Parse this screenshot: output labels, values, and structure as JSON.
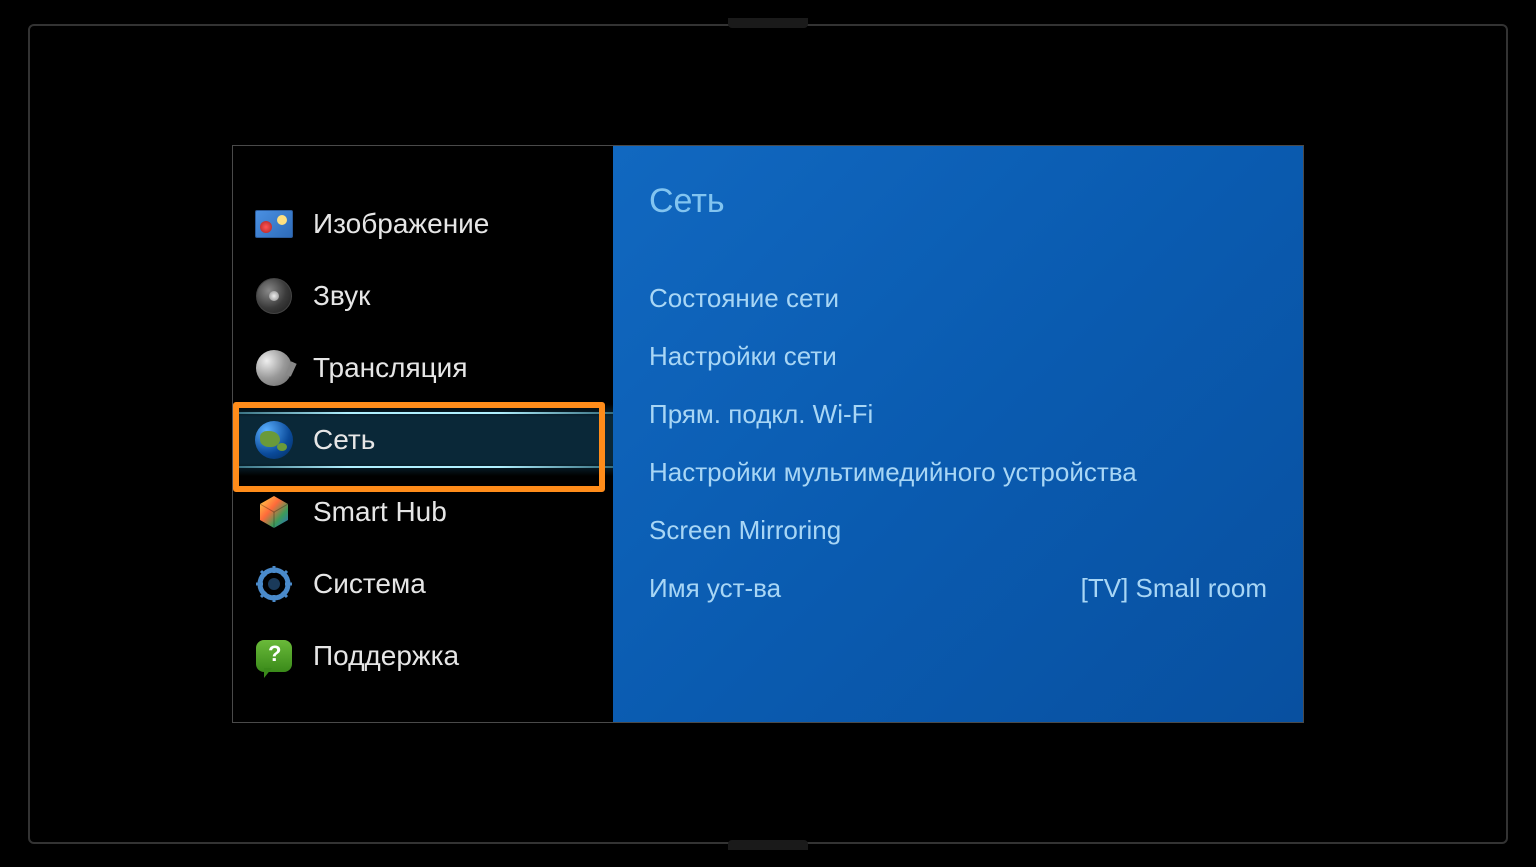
{
  "sidebar": {
    "items": [
      {
        "label": "Изображение",
        "icon": "picture-icon"
      },
      {
        "label": "Звук",
        "icon": "sound-icon"
      },
      {
        "label": "Трансляция",
        "icon": "broadcast-icon"
      },
      {
        "label": "Сеть",
        "icon": "globe-icon"
      },
      {
        "label": "Smart Hub",
        "icon": "smarthub-icon"
      },
      {
        "label": "Система",
        "icon": "system-icon"
      },
      {
        "label": "Поддержка",
        "icon": "support-icon"
      }
    ],
    "selected_index": 3
  },
  "panel": {
    "title": "Сеть",
    "items": [
      {
        "label": "Состояние сети",
        "value": ""
      },
      {
        "label": "Настройки сети",
        "value": ""
      },
      {
        "label": "Прям. подкл. Wi-Fi",
        "value": ""
      },
      {
        "label": "Настройки мультимедийного устройства",
        "value": ""
      },
      {
        "label": "Screen Mirroring",
        "value": ""
      },
      {
        "label": "Имя уст-ва",
        "value": "[TV] Small room"
      }
    ]
  }
}
